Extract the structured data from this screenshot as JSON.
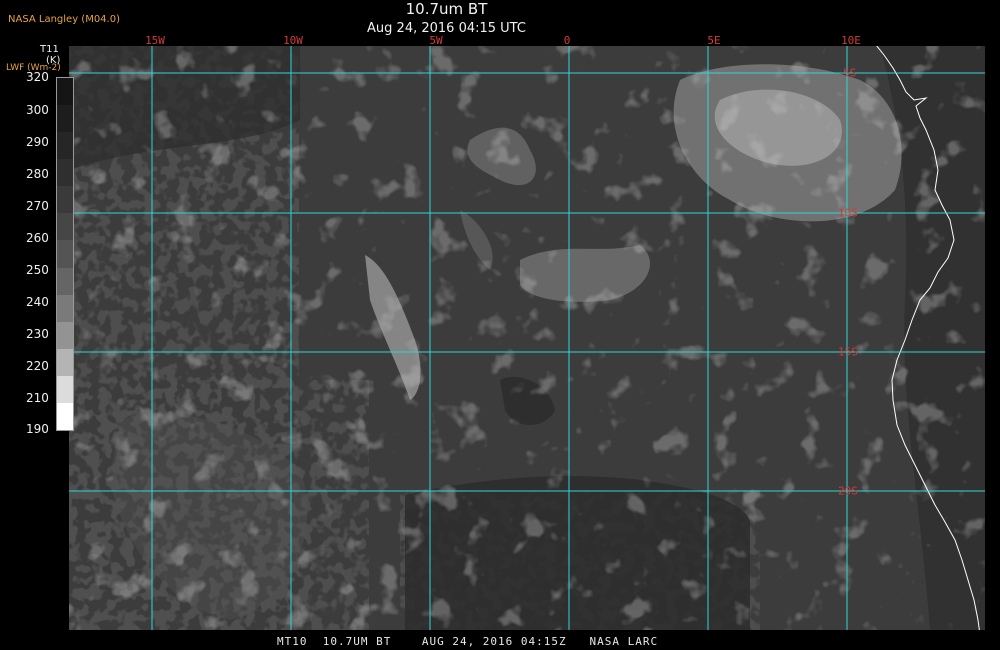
{
  "header": {
    "organization": "NASA Langley (M04.0)",
    "title": "10.7um BT",
    "subtitle": "Aug 24, 2016 04:15 UTC"
  },
  "colorbar": {
    "variable": "T11",
    "units": "(K)",
    "secondary_label": "LWF (Wm-2)",
    "ticks": [
      "320",
      "300",
      "290",
      "280",
      "270",
      "260",
      "250",
      "240",
      "230",
      "220",
      "210",
      "190"
    ],
    "colors": [
      "#151515",
      "#1d1d1d",
      "#262626",
      "#2f2f2f",
      "#3a3a3a",
      "#464646",
      "#545454",
      "#656565",
      "#7a7a7a",
      "#939393",
      "#b4b4b4",
      "#dcdcdc",
      "#ffffff"
    ]
  },
  "map": {
    "longitude_labels": [
      "15W",
      "10W",
      "5W",
      "0",
      "5E",
      "10E"
    ],
    "latitude_labels": [
      "5S",
      "10S",
      "15S",
      "20S"
    ],
    "grid_color": "#2fd6d6",
    "coastline_color": "#ffffff",
    "background_gray": "#3c3c3c"
  },
  "footer": {
    "text": "MT10  10.7UM BT    AUG 24, 2016 04:15Z   NASA LARC"
  }
}
